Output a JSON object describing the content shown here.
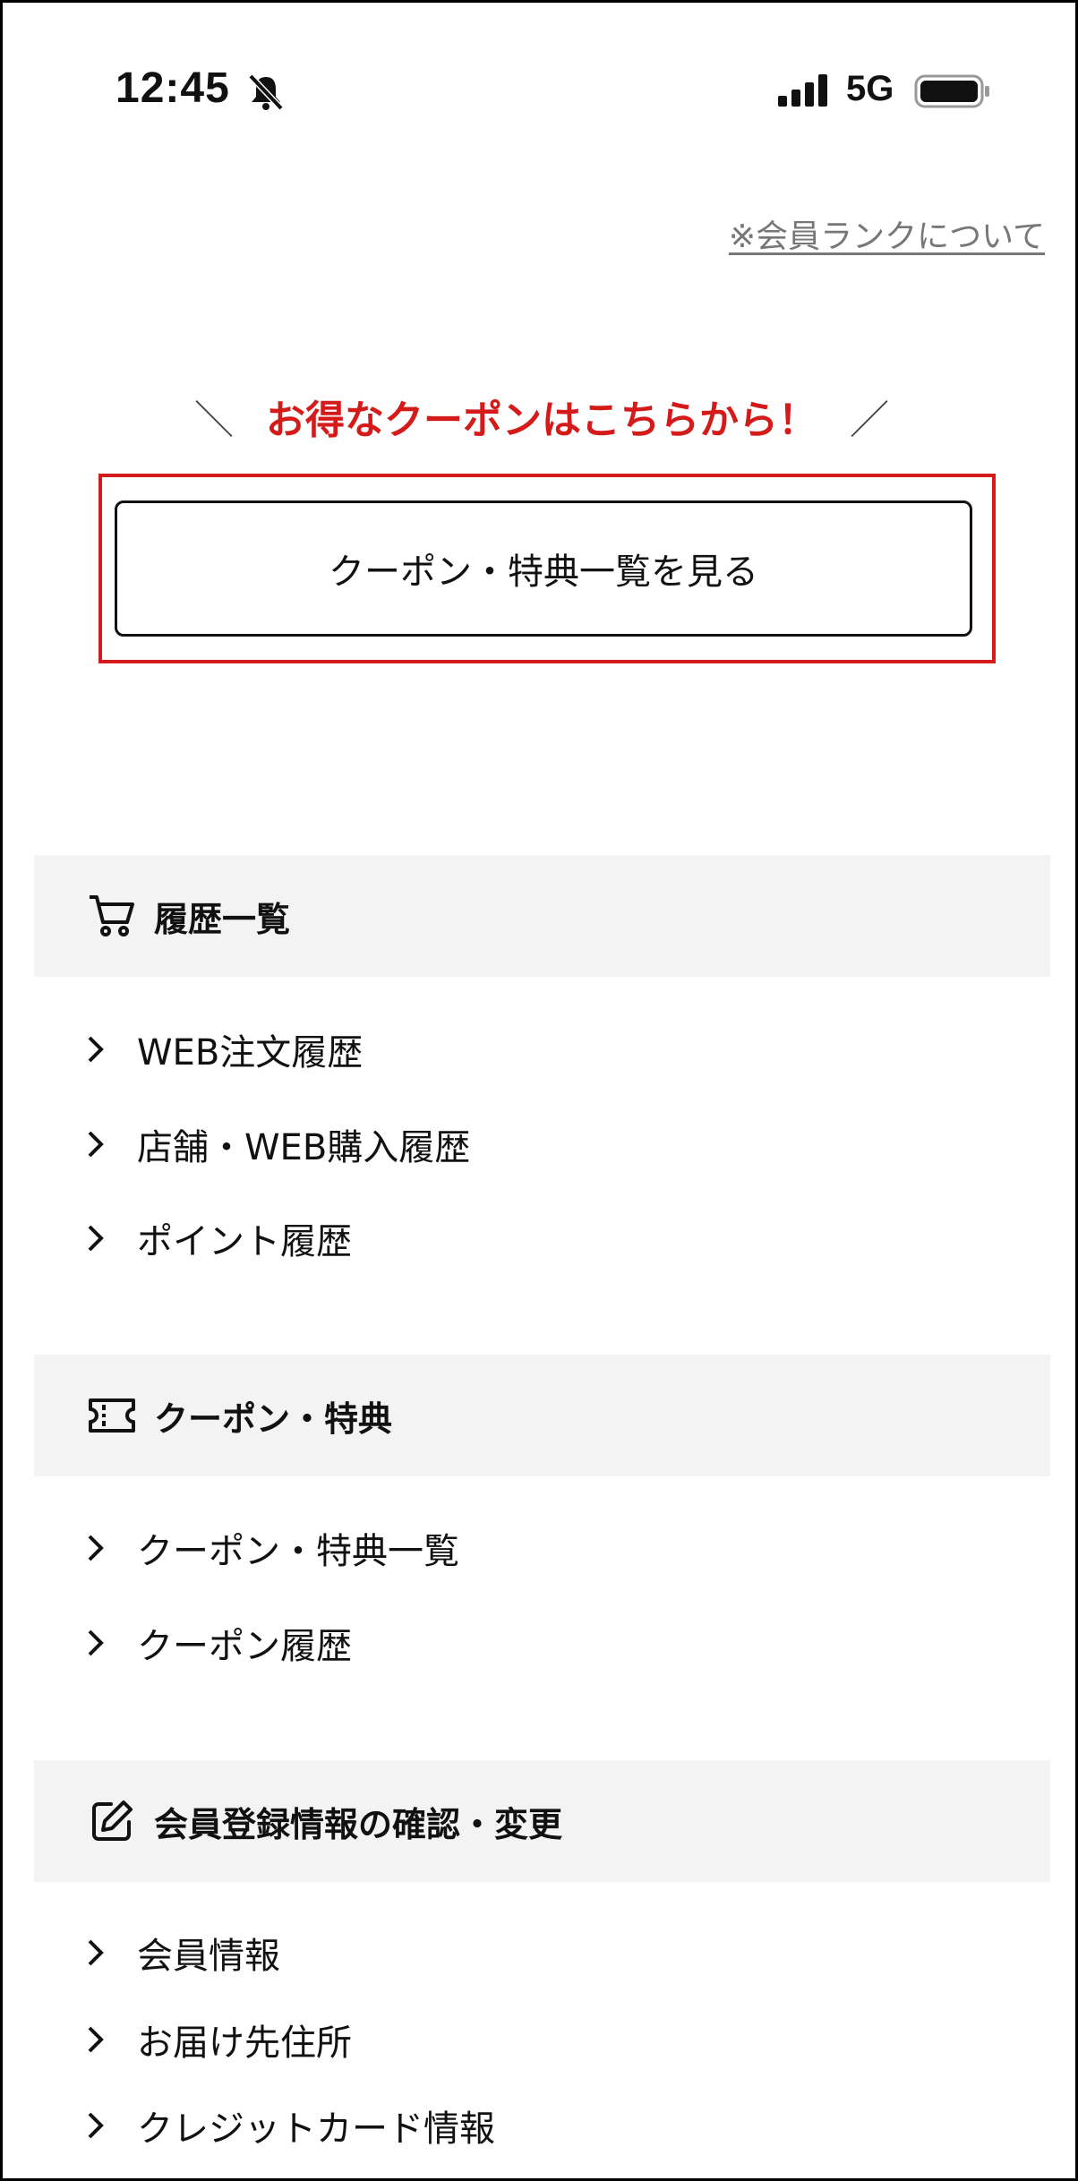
{
  "status_bar": {
    "time": "12:45",
    "network": "5G",
    "icons": [
      "bell-muted-icon",
      "signal-icon",
      "battery-icon"
    ]
  },
  "rank_link": "※会員ランクについて",
  "promo": {
    "left_slash": "＼",
    "headline": "お得なクーポンはこちらから！",
    "right_slash": "／",
    "button_label": "クーポン・特典一覧を見る"
  },
  "sections": {
    "history": {
      "title": "履歴一覧",
      "icon": "cart-icon",
      "items": [
        "WEB注文履歴",
        "店舗・WEB購入履歴",
        "ポイント履歴"
      ]
    },
    "coupon": {
      "title": "クーポン・特典",
      "icon": "ticket-icon",
      "items": [
        "クーポン・特典一覧",
        "クーポン履歴"
      ]
    },
    "member": {
      "title": "会員登録情報の確認・変更",
      "icon": "edit-icon",
      "items": [
        "会員情報",
        "お届け先住所",
        "クレジットカード情報"
      ]
    }
  },
  "colors": {
    "accent_red": "#d51a1a",
    "section_bg": "#f3f3f3",
    "link_gray": "#777777"
  }
}
